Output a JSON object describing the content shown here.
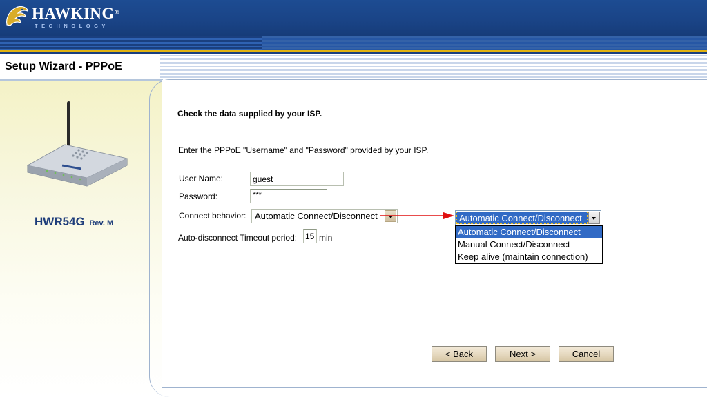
{
  "brand": {
    "name": "HAWKING",
    "registered": "®",
    "subtitle": "TECHNOLOGY"
  },
  "page": {
    "title": "Setup Wizard - PPPoE"
  },
  "sidebar": {
    "model": "HWR54G",
    "revision": "Rev. M"
  },
  "form": {
    "heading": "Check the data supplied by your ISP.",
    "instruction": "Enter the PPPoE \"Username\" and \"Password\" provided by your ISP.",
    "username_label": "User Name:",
    "username_value": "guest",
    "password_label": "Password:",
    "password_value": "***",
    "connect_label": "Connect behavior:",
    "connect_value": "Automatic Connect/Disconnect",
    "timeout_label": "Auto-disconnect Timeout period:",
    "timeout_value": "15",
    "timeout_unit": "min"
  },
  "dropdown_callout": {
    "selected": "Automatic Connect/Disconnect",
    "options": [
      "Automatic Connect/Disconnect",
      "Manual Connect/Disconnect",
      "Keep alive (maintain connection)"
    ],
    "highlighted_index": 0
  },
  "buttons": {
    "back": "< Back",
    "next": "Next >",
    "cancel": "Cancel"
  },
  "colors": {
    "header_blue": "#1a4487",
    "accent_gold": "#e2b310",
    "selection_blue": "#316ac5",
    "callout_arrow": "#e01010",
    "model_text": "#1d3c7a"
  }
}
